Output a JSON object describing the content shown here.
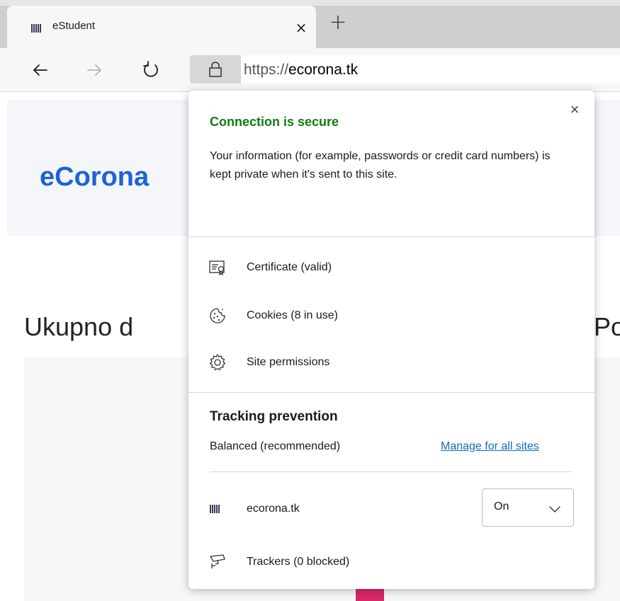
{
  "tab": {
    "title": "eStudent",
    "close_label": "×",
    "newtab_label": "+"
  },
  "address_bar": {
    "scheme": "https://",
    "host": "ecorona.tk"
  },
  "page": {
    "brand": "eCorona",
    "heading_left": "Ukupno d",
    "heading_right": "Po"
  },
  "flyout": {
    "close_label": "×",
    "title": "Connection is secure",
    "description": "Your information (for example, passwords or credit card numbers) is kept private when it's sent to this site.",
    "items": [
      {
        "label": "Certificate (valid)",
        "icon": "certificate-icon"
      },
      {
        "label": "Cookies (8 in use)",
        "icon": "cookie-icon"
      },
      {
        "label": "Site permissions",
        "icon": "gear-icon"
      }
    ],
    "tracking": {
      "title": "Tracking prevention",
      "level": "Balanced (recommended)",
      "manage_link": "Manage for all sites",
      "site": "ecorona.tk",
      "toggle_value": "On",
      "trackers": "Trackers (0 blocked)"
    }
  },
  "colors": {
    "secure_green": "#107c10",
    "link_blue": "#0f6cbd",
    "brand_blue": "#1c63d6",
    "accent_pink": "#d9276a"
  }
}
